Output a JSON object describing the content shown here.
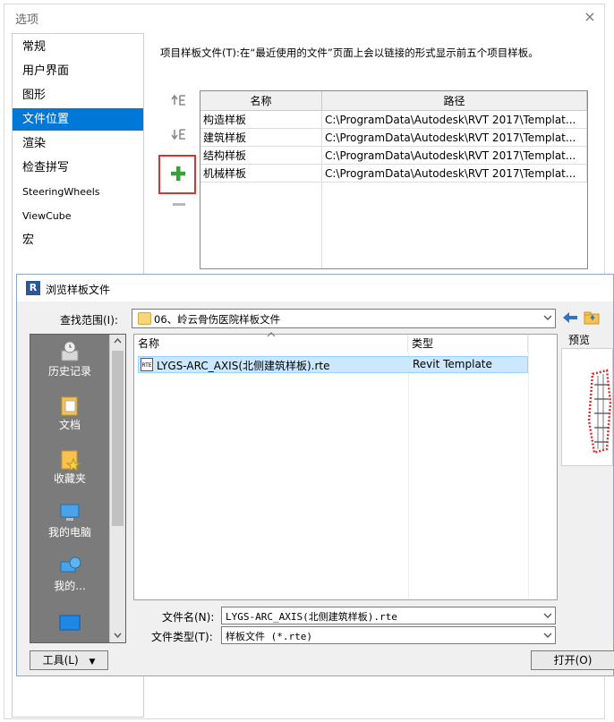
{
  "options": {
    "title": "选项",
    "close_glyph": "×",
    "nav": [
      "常规",
      "用户界面",
      "图形",
      "文件位置",
      "渲染",
      "检查拼写",
      "SteeringWheels",
      "ViewCube",
      "宏"
    ],
    "selected_nav": "文件位置",
    "description": "项目样板文件(T):在“最近使用的文件”页面上会以链接的形式显示前五个项目样板。",
    "tool_icons": [
      "move-up-icon",
      "move-down-icon",
      "add-icon",
      "remove-icon"
    ],
    "table": {
      "headers": [
        "名称",
        "路径"
      ],
      "rows": [
        {
          "name": "构造样板",
          "path": "C:\\ProgramData\\Autodesk\\RVT 2017\\Templat..."
        },
        {
          "name": "建筑样板",
          "path": "C:\\ProgramData\\Autodesk\\RVT 2017\\Templat..."
        },
        {
          "name": "结构样板",
          "path": "C:\\ProgramData\\Autodesk\\RVT 2017\\Templat..."
        },
        {
          "name": "机械样板",
          "path": "C:\\ProgramData\\Autodesk\\RVT 2017\\Templat..."
        }
      ]
    },
    "accent_color": "#0078d7",
    "highlight_color": "#e03030"
  },
  "browse": {
    "title": "浏览样板文件",
    "app_icon_letter": "R",
    "lookin_label": "查找范围(I):",
    "lookin_value": "06、岭云骨伤医院样板文件",
    "places": [
      "历史记录",
      "文档",
      "收藏夹",
      "我的电脑",
      "我的..."
    ],
    "columns": [
      "名称",
      "类型"
    ],
    "file": {
      "name": "LYGS-ARC_AXIS(北侧建筑样板).rte",
      "type": "Revit Template",
      "icon_text": "RTE"
    },
    "preview_label": "预览",
    "filename_label": "文件名(N):",
    "filename_value": "LYGS-ARC_AXIS(北侧建筑样板).rte",
    "filetype_label": "文件类型(T):",
    "filetype_value": "样板文件 (*.rte)",
    "tools_button": "工具(L)",
    "open_button": "打开(O)"
  }
}
